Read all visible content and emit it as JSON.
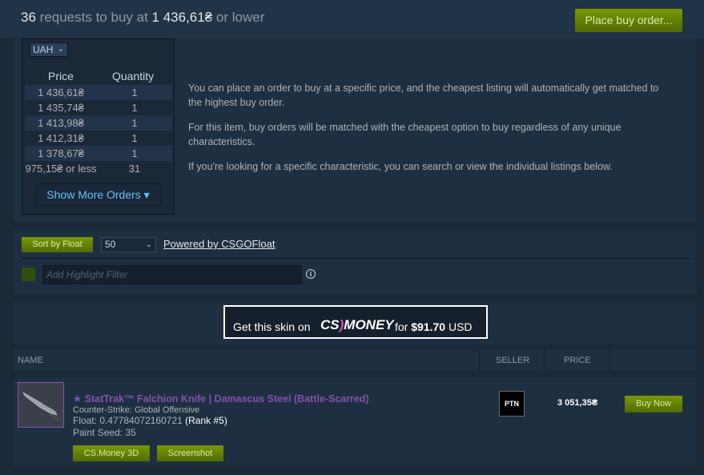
{
  "header": {
    "count": "36",
    "text_before": "requests to buy at",
    "price": "1 436,61₴",
    "text_after": "or lower",
    "place_order_label": "Place buy order..."
  },
  "orderbook": {
    "currency": "UAH",
    "price_header": "Price",
    "quantity_header": "Quantity",
    "rows": [
      {
        "price": "1 436,61₴",
        "qty": "1"
      },
      {
        "price": "1 435,74₴",
        "qty": "1"
      },
      {
        "price": "1 413,98₴",
        "qty": "1"
      },
      {
        "price": "1 412,31₴",
        "qty": "1"
      },
      {
        "price": "1 378,67₴",
        "qty": "1"
      },
      {
        "price": "975,15₴ or less",
        "qty": "31"
      }
    ],
    "show_more": "Show More Orders"
  },
  "info": {
    "p1": "You can place an order to buy at a specific price, and the cheapest listing will automatically get matched to the highest buy order.",
    "p2": "For this item, buy orders will be matched with the cheapest option to buy regardless of any unique characteristics.",
    "p3": "If you're looking for a specific characteristic, you can search or view the individual listings below."
  },
  "filters": {
    "sort_label": "Sort by Float",
    "count_value": "50",
    "powered_label": "Powered by CSGOFloat",
    "highlight_placeholder": "Add Highlight Filter",
    "swatch_color": "#2f4f0a"
  },
  "promo": {
    "text1": "Get this skin on",
    "logo_left": "CS",
    "logo_right": "MONEY",
    "text2": "for",
    "price": "$91.70",
    "currency": "USD"
  },
  "columns": {
    "name": "NAME",
    "seller": "SELLER",
    "price": "PRICE"
  },
  "listing": {
    "name": "★ StatTrak™ Falchion Knife | Damascus Steel (Battle-Scarred)",
    "game": "Counter-Strike: Global Offensive",
    "float_label": "Float: 0.47784072160721",
    "rank": "(Rank #5)",
    "seed": "Paint Seed: 35",
    "btn_3d": "CS.Money 3D",
    "btn_screenshot": "Screenshot",
    "seller_avatar": "PTN",
    "price": "3 051,35₴",
    "buy_label": "Buy Now",
    "name_color": "#8650ac"
  }
}
